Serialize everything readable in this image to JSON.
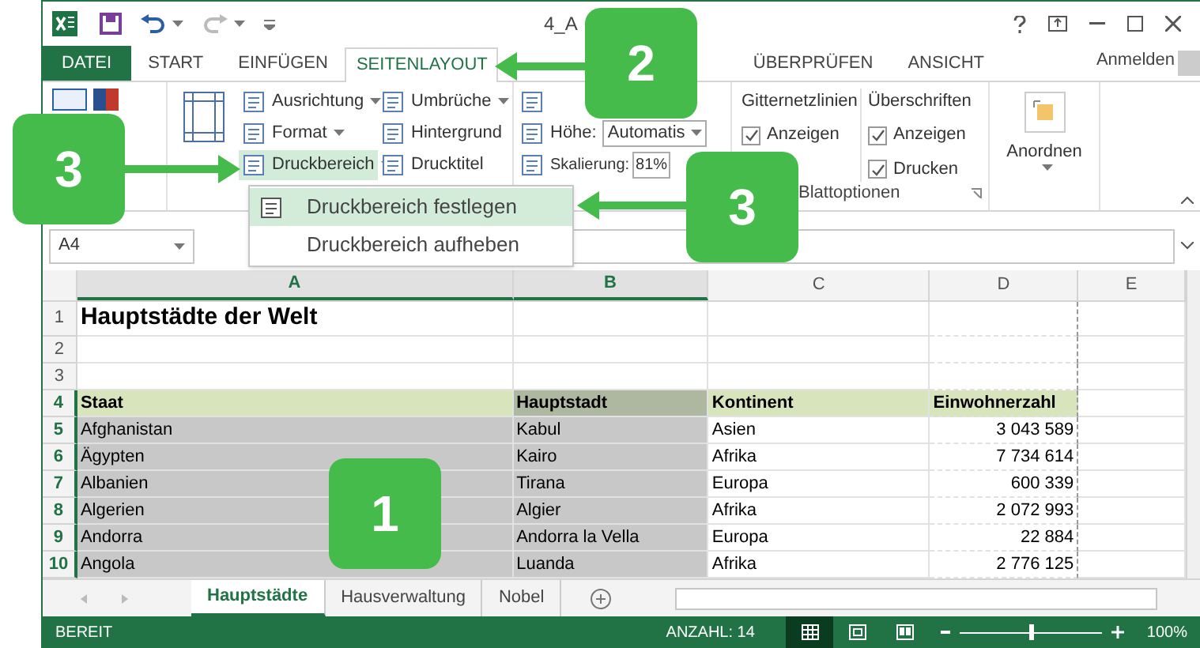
{
  "title_bar": {
    "title": "4_A"
  },
  "tabs": [
    {
      "label": "DATEI",
      "kind": "file",
      "selected": false
    },
    {
      "label": "START",
      "kind": "tab",
      "selected": false
    },
    {
      "label": "EINFÜGEN",
      "kind": "tab",
      "selected": false
    },
    {
      "label": "SEITENLAYOUT",
      "kind": "tab",
      "selected": true
    },
    {
      "label": "ÜBERPRÜFEN",
      "kind": "tab",
      "selected": false
    },
    {
      "label": "ANSICHT",
      "kind": "tab",
      "selected": false
    }
  ],
  "account": "Anmelden",
  "page_setup": [
    {
      "label": "Ausrichtung",
      "dropdown": true,
      "active": false
    },
    {
      "label": "Format",
      "dropdown": true,
      "active": false
    },
    {
      "label": "Druckbereich",
      "dropdown": true,
      "active": true
    },
    {
      "label": "Umbrüche",
      "dropdown": true,
      "active": false
    },
    {
      "label": "Hintergrund",
      "dropdown": false,
      "active": false
    },
    {
      "label": "Drucktitel",
      "dropdown": false,
      "active": false
    }
  ],
  "scale": {
    "height_label": "Höhe:",
    "height_value": "Automatis",
    "scale_label": "Skalierung:",
    "scale_value": "81%"
  },
  "sheet_options": {
    "label": "Blattoptionen",
    "groups": [
      {
        "title": "Gitternetzlinien",
        "options": [
          {
            "label": "Anzeigen",
            "checked": true
          }
        ]
      },
      {
        "title": "Überschriften",
        "options": [
          {
            "label": "Anzeigen",
            "checked": true
          },
          {
            "label": "Drucken",
            "checked": true
          }
        ]
      }
    ]
  },
  "arrange": {
    "label": "Anordnen"
  },
  "menu": {
    "items": [
      {
        "label": "Druckbereich festlegen",
        "selected": true
      },
      {
        "label": "Druckbereich aufheben",
        "selected": false
      }
    ]
  },
  "name_box": "A4",
  "sheet": {
    "columns": [
      {
        "label": "A",
        "selected": true
      },
      {
        "label": "B",
        "selected": true
      },
      {
        "label": "C",
        "selected": false
      },
      {
        "label": "D",
        "selected": false
      },
      {
        "label": "E",
        "selected": false
      }
    ],
    "rows": [
      {
        "number": "1",
        "kind": "title",
        "selected": false,
        "cells": [
          "Hauptstädte der Welt"
        ]
      },
      {
        "number": "2",
        "kind": "blank",
        "selected": false,
        "cells": []
      },
      {
        "number": "3",
        "kind": "blank",
        "selected": false,
        "cells": []
      },
      {
        "number": "4",
        "kind": "header",
        "selected": true,
        "cells": [
          "Staat",
          "Hauptstadt",
          "Kontinent",
          "Einwohnerzahl"
        ]
      },
      {
        "number": "5",
        "kind": "data",
        "selected": true,
        "cells": [
          "Afghanistan",
          "Kabul",
          "Asien",
          "3 043 589"
        ]
      },
      {
        "number": "6",
        "kind": "data",
        "selected": true,
        "cells": [
          "Ägypten",
          "Kairo",
          "Afrika",
          "7 734 614"
        ]
      },
      {
        "number": "7",
        "kind": "data",
        "selected": true,
        "cells": [
          "Albanien",
          "Tirana",
          "Europa",
          "600 339"
        ]
      },
      {
        "number": "8",
        "kind": "data",
        "selected": true,
        "cells": [
          "Algerien",
          "Algier",
          "Afrika",
          "2 072 993"
        ]
      },
      {
        "number": "9",
        "kind": "data",
        "selected": true,
        "cells": [
          "Andorra",
          "Andorra la Vella",
          "Europa",
          "22 884"
        ]
      },
      {
        "number": "10",
        "kind": "data",
        "selected": true,
        "cells": [
          "Angola",
          "Luanda",
          "Afrika",
          "2 776 125"
        ]
      }
    ]
  },
  "sheet_tabs": [
    {
      "label": "Hauptstädte",
      "selected": true
    },
    {
      "label": "Hausverwaltung",
      "selected": false
    },
    {
      "label": "Nobel",
      "selected": false
    }
  ],
  "status_bar": {
    "status": "BEREIT",
    "count": "ANZAHL: 14",
    "zoom": "100%",
    "level": 0.5,
    "views": [
      {
        "kind": "normal",
        "selected": true
      },
      {
        "kind": "page_layout",
        "selected": false
      },
      {
        "kind": "page_break",
        "selected": false
      }
    ]
  },
  "callouts": [
    {
      "number": "2"
    },
    {
      "number": "3"
    },
    {
      "number": "3"
    },
    {
      "number": "1"
    }
  ]
}
